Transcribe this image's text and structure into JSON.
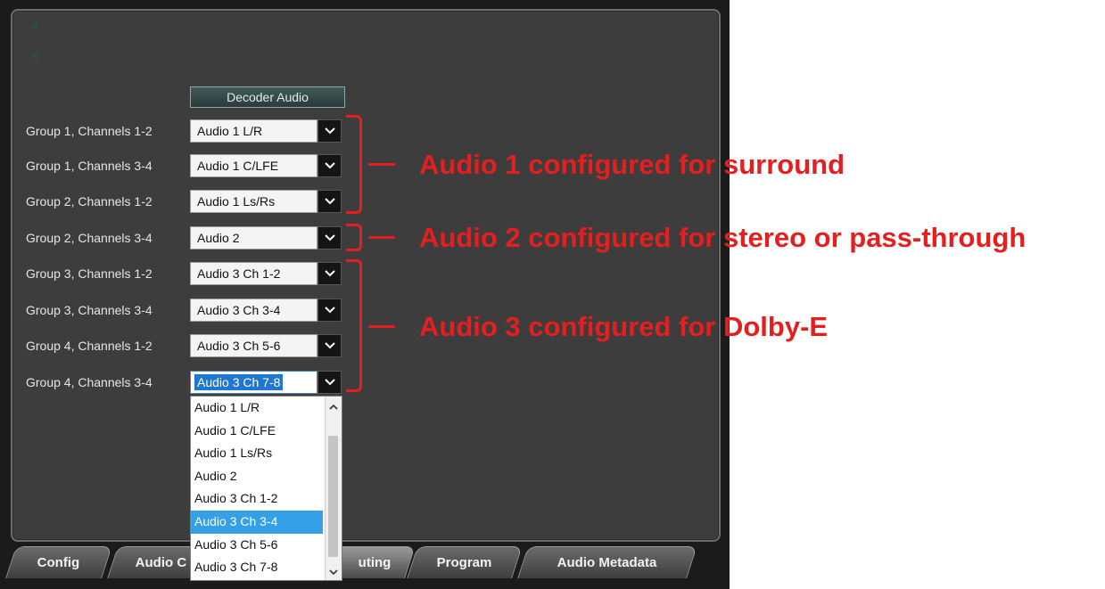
{
  "header": {
    "decoder_audio_label": "Decoder Audio"
  },
  "rows": [
    {
      "label": "Group 1, Channels 1-2",
      "value": "Audio 1 L/R"
    },
    {
      "label": "Group 1, Channels 3-4",
      "value": "Audio 1 C/LFE"
    },
    {
      "label": "Group 2, Channels 1-2",
      "value": "Audio 1 Ls/Rs"
    },
    {
      "label": "Group 2, Channels 3-4",
      "value": "Audio 2"
    },
    {
      "label": "Group 3, Channels 1-2",
      "value": "Audio 3 Ch 1-2"
    },
    {
      "label": "Group 3, Channels 3-4",
      "value": "Audio 3 Ch 3-4"
    },
    {
      "label": "Group 4, Channels 1-2",
      "value": "Audio 3 Ch 5-6"
    },
    {
      "label": "Group 4, Channels 3-4",
      "value": "Audio 3 Ch 7-8"
    }
  ],
  "dropdown": {
    "options": [
      "Audio 1 L/R",
      "Audio 1 C/LFE",
      "Audio 1 Ls/Rs",
      "Audio 2",
      "Audio 3 Ch 1-2",
      "Audio 3 Ch 3-4",
      "Audio 3 Ch 5-6",
      "Audio 3 Ch 7-8"
    ],
    "highlighted": "Audio 3 Ch 3-4"
  },
  "tabs": [
    {
      "label": "Config"
    },
    {
      "label": "Audio C"
    },
    {
      "label": "uting"
    },
    {
      "label": "Program"
    },
    {
      "label": "Audio Metadata"
    }
  ],
  "annotations": {
    "surround": "Audio 1 configured for surround",
    "stereo": "Audio 2 configured for stereo or pass-through",
    "dolby": "Audio 3 configured for Dolby-E"
  },
  "colors": {
    "annotation": "#e41f1f",
    "highlight": "#36a0e6",
    "panel": "#3d3d3d"
  }
}
